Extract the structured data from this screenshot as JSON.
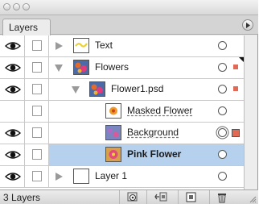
{
  "window": {
    "tab_label": "Layers"
  },
  "layers": [
    {
      "name": "Text",
      "kind": "text-layer",
      "visible": true,
      "expanded": false,
      "selected": false,
      "style": "normal",
      "mask_indicator": false,
      "big_mask": false
    },
    {
      "name": "Flowers",
      "kind": "group",
      "visible": true,
      "expanded": true,
      "selected": false,
      "style": "normal",
      "mask_indicator": true,
      "big_mask": false
    },
    {
      "name": "Flower1.psd",
      "kind": "group",
      "visible": true,
      "expanded": true,
      "selected": false,
      "style": "normal",
      "mask_indicator": true,
      "big_mask": false
    },
    {
      "name": "Masked Flower",
      "kind": "layer",
      "visible": false,
      "expanded": null,
      "selected": false,
      "style": "dotted",
      "mask_indicator": false,
      "big_mask": false
    },
    {
      "name": "Background",
      "kind": "layer",
      "visible": true,
      "expanded": null,
      "selected": false,
      "style": "dotted",
      "mask_indicator": true,
      "big_mask": true
    },
    {
      "name": "Pink Flower",
      "kind": "layer",
      "visible": true,
      "expanded": null,
      "selected": true,
      "style": "bold",
      "mask_indicator": false,
      "big_mask": false
    },
    {
      "name": "Layer 1",
      "kind": "layer-collapsed",
      "visible": true,
      "expanded": false,
      "selected": false,
      "style": "normal",
      "mask_indicator": false,
      "big_mask": false
    }
  ],
  "footer": {
    "layer_count": "3 Layers"
  },
  "colors": {
    "selection": "#b6d1ee",
    "mask_indicator": "#e06a55"
  }
}
